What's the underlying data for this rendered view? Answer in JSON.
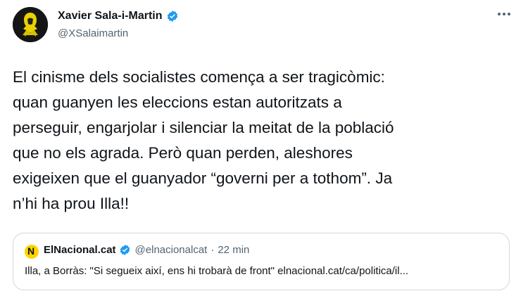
{
  "author": {
    "name": "Xavier Sala-i-Martin",
    "handle": "@XSalaimartin"
  },
  "tweet": {
    "text": "El cinisme dels socialistes comença a ser tragicòmic:\nquan guanyen les eleccions estan autoritzats a\nperseguir, engarjolar i silenciar la meitat de la població\nque no els agrada. Però quan perden, aleshores\nexigeixen que el guanyador “governi per a tothom”. Ja\nn’hi ha prou Illa!!"
  },
  "quoted": {
    "logo_letter": "N",
    "name": "ElNacional.cat",
    "handle": "@elnacionalcat",
    "separator": "·",
    "time": "22 min",
    "text": "Illa, a Borràs: \"Si segueix així, ens hi trobarà de front\" elnacional.cat/ca/politica/il..."
  },
  "icons": {
    "verified": "verified-badge-icon",
    "more": "more-options-icon"
  },
  "colors": {
    "verified_blue": "#1d9bf0",
    "secondary_text": "#536471",
    "border": "#cfd9de",
    "logo_yellow": "#ffd400"
  }
}
